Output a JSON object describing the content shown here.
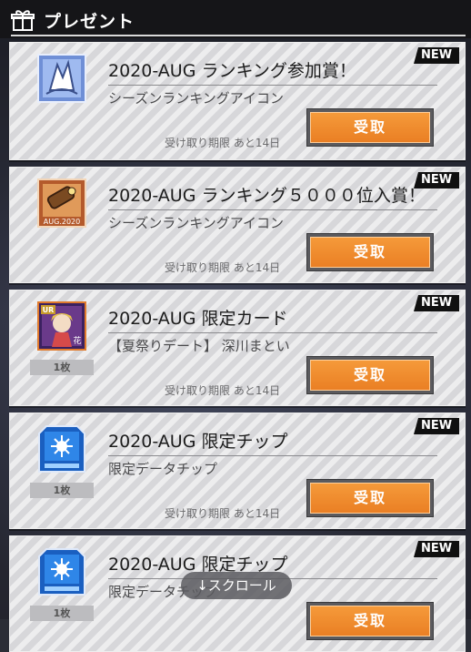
{
  "header": {
    "title": "プレゼント"
  },
  "colors": {
    "accent": "#ea7f24",
    "badge": "#101010"
  },
  "items": [
    {
      "new": "NEW",
      "icon": "ranking-badge-icon",
      "title": "2020-AUG ランキング参加賞！",
      "subtitle": "シーズンランキングアイコン",
      "quantity": "",
      "expire": "受け取り期限 あと14日",
      "button": "受取"
    },
    {
      "new": "NEW",
      "icon": "ranking-5000-icon",
      "icon_caption": "AUG.2020",
      "title": "2020-AUG ランキング５０００位入賞！",
      "subtitle": "シーズンランキングアイコン",
      "quantity": "",
      "expire": "受け取り期限 あと14日",
      "button": "受取"
    },
    {
      "new": "NEW",
      "icon": "ur-card-icon",
      "icon_tag": "UR",
      "icon_tag2": "花",
      "title": "2020-AUG 限定カード",
      "subtitle": "【夏祭りデート】 深川まとい",
      "quantity": "1枚",
      "expire": "受け取り期限 あと14日",
      "button": "受取"
    },
    {
      "new": "NEW",
      "icon": "data-chip-icon",
      "title": "2020-AUG 限定チップ",
      "subtitle": "限定データチップ",
      "quantity": "1枚",
      "expire": "受け取り期限 あと14日",
      "button": "受取"
    },
    {
      "new": "NEW",
      "icon": "data-chip-icon",
      "title": "2020-AUG 限定チップ",
      "subtitle": "限定データチップ",
      "quantity": "1枚",
      "expire": "",
      "button": "受取"
    }
  ],
  "scroll_hint": "↓スクロール"
}
